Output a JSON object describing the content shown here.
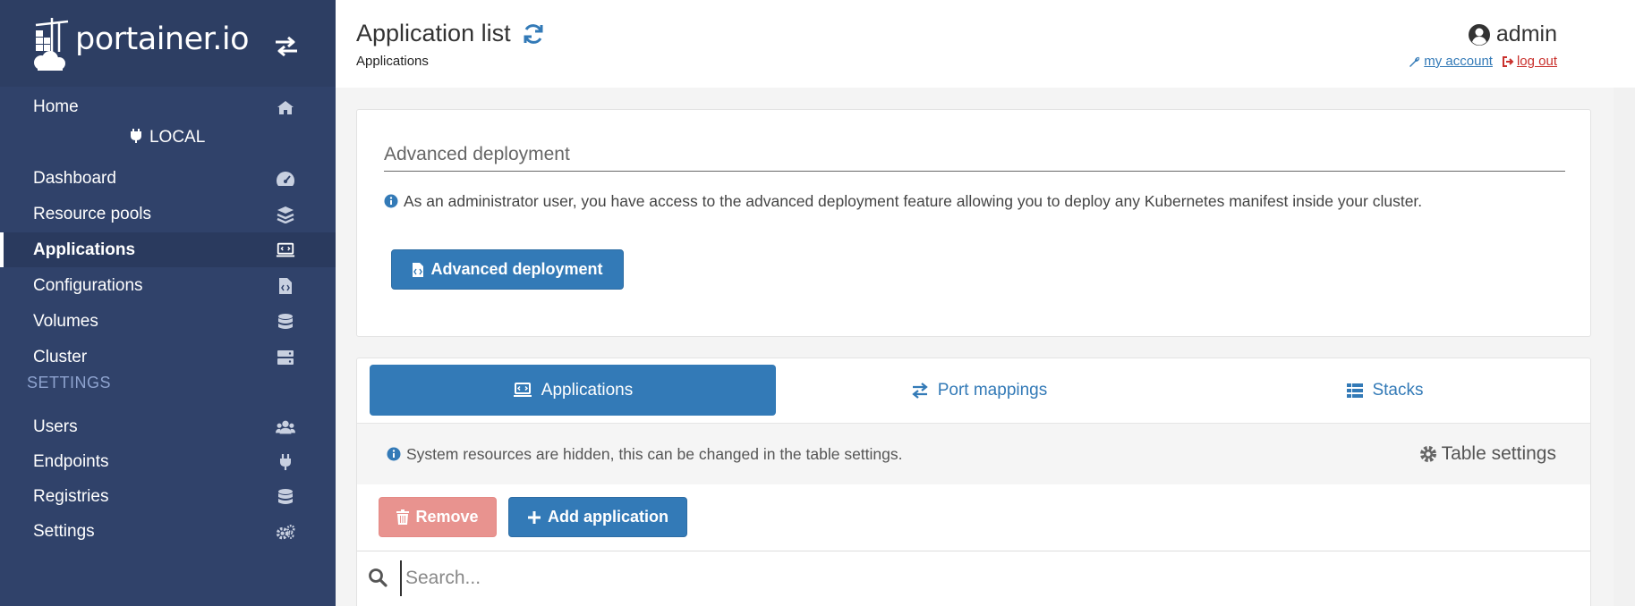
{
  "brand": {
    "name": "portainer.io"
  },
  "sidebar": {
    "items": [
      {
        "label": "Home",
        "icon": "home-icon"
      },
      {
        "label": "Dashboard",
        "icon": "tachometer-icon"
      },
      {
        "label": "Resource pools",
        "icon": "layers-icon"
      },
      {
        "label": "Applications",
        "icon": "laptop-code-icon",
        "active": true
      },
      {
        "label": "Configurations",
        "icon": "file-code-icon"
      },
      {
        "label": "Volumes",
        "icon": "database-icon"
      },
      {
        "label": "Cluster",
        "icon": "server-icon"
      }
    ],
    "local_label": "LOCAL",
    "settings_header": "SETTINGS",
    "settings_items": [
      {
        "label": "Users",
        "icon": "users-icon"
      },
      {
        "label": "Endpoints",
        "icon": "plug-icon"
      },
      {
        "label": "Registries",
        "icon": "database-icon"
      },
      {
        "label": "Settings",
        "icon": "cogs-icon"
      }
    ]
  },
  "header": {
    "title": "Application list",
    "breadcrumb": "Applications",
    "username": "admin",
    "my_account": "my account",
    "log_out": "log out"
  },
  "advanced": {
    "title": "Advanced deployment",
    "note": "As an administrator user, you have access to the advanced deployment feature allowing you to deploy any Kubernetes manifest inside your cluster.",
    "button": "Advanced deployment"
  },
  "tabs": [
    {
      "label": "Applications",
      "icon": "laptop-code-icon",
      "active": true
    },
    {
      "label": "Port mappings",
      "icon": "exchange-icon"
    },
    {
      "label": "Stacks",
      "icon": "list-icon"
    }
  ],
  "table": {
    "notice": "System resources are hidden, this can be changed in the table settings.",
    "settings_label": "Table settings",
    "remove_label": "Remove",
    "add_label": "Add application",
    "search_placeholder": "Search..."
  },
  "colors": {
    "sidebar": "#30426a",
    "primary": "#337ab7",
    "danger": "#e8938f"
  }
}
